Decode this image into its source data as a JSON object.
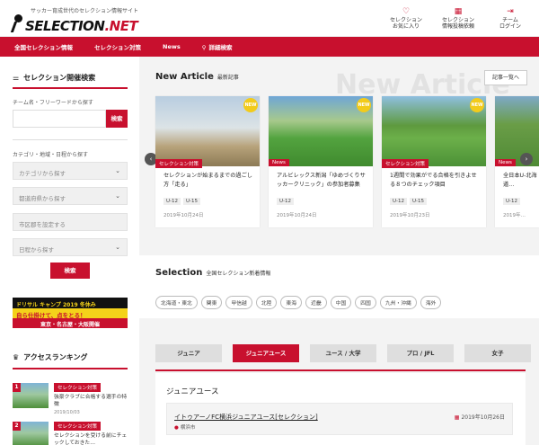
{
  "header": {
    "tagline": "サッカー育成世代のセレクション情報サイト",
    "logo_main": "SELECTION",
    "logo_suffix": ".NET",
    "actions": [
      {
        "icon": "heart-icon",
        "glyph": "♡",
        "label1": "セレクション",
        "label2": "お気に入り"
      },
      {
        "icon": "calendar-icon",
        "glyph": "▦",
        "label1": "セレクション",
        "label2": "情報投稿依頼"
      },
      {
        "icon": "login-icon",
        "glyph": "⇥",
        "label1": "チーム",
        "label2": "ログイン"
      }
    ]
  },
  "nav": {
    "items": [
      "全国セレクション情報",
      "セレクション対策",
      "News",
      "詳細検索"
    ]
  },
  "sidebar": {
    "search_title": "セレクション開催検索",
    "keyword_label": "チーム名・フリーワードから探す",
    "search_button": "検索",
    "filter_label": "カテゴリ・地域・日程から探す",
    "category_select": "カテゴリから探す",
    "prefecture_select": "都道府県から探す",
    "city_select": "市区郡を設定する",
    "date_select": "日程から探す",
    "submit_button": "検索",
    "banner": {
      "line1": "ドリサル キャンプ 2019 冬休み",
      "line2": "自ら仕掛けて、点をとる！",
      "line3": "東京・名古屋・大阪開催"
    },
    "ranking_title": "アクセスランキング",
    "ranking": [
      {
        "num": "1",
        "category": "セレクション対策",
        "text": "強豪クラブに合格する選手の特徴",
        "date": "2019/10/03"
      },
      {
        "num": "2",
        "category": "セレクション対策",
        "text": "セレクションを受ける前にチェックしておきた…",
        "date": ""
      }
    ]
  },
  "main": {
    "new_article_title": "New Article",
    "new_article_sub": "最新記事",
    "bg_text": "New Article",
    "list_button": "記事一覧へ",
    "cards": [
      {
        "category": "セレクション対策",
        "title": "セレクションが始まるまでの過ごし方「走る」",
        "tags": [
          "U-12",
          "U-15"
        ],
        "date": "2019年10月24日",
        "new": "NEW"
      },
      {
        "category": "News",
        "title": "アルビレックス新潟「ゆめづくりサッカークリニック」の参加者募集",
        "tags": [
          "U-12"
        ],
        "date": "2019年10月24日",
        "new": "NEW"
      },
      {
        "category": "セレクション対策",
        "title": "1週間で効果がでる合格を引きよせる８つのチェック項目",
        "tags": [
          "U-12",
          "U-15"
        ],
        "date": "2019年10月23日",
        "new": "NEW"
      },
      {
        "category": "News",
        "title": "全日本U-北海道…",
        "tags": [
          "U-12"
        ],
        "date": "2019年…",
        "new": ""
      }
    ],
    "selection_title": "Selection",
    "selection_sub": "全国セレクション新着情報",
    "regions": [
      "北海道・東北",
      "関東",
      "甲信越",
      "北陸",
      "東海",
      "近畿",
      "中国",
      "四国",
      "九州・沖縄",
      "海外"
    ],
    "tabs": [
      "ジュニア",
      "ジュニアユース",
      "ユース / 大学",
      "プロ / JFL",
      "女子"
    ],
    "active_tab": 1,
    "panel_title": "ジュニアユース",
    "event": {
      "title": "イトゥアーノFC横浜ジュニアユース[セレクション]",
      "date": "2019年10月26日",
      "location": "横浜市"
    }
  }
}
